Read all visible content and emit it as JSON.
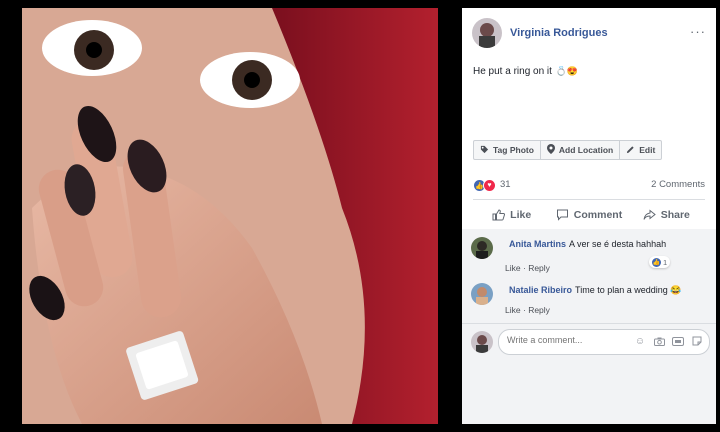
{
  "post": {
    "author_name": "Virginia Rodrigues",
    "more_label": "···",
    "caption": "He put a ring on it",
    "caption_emoji": "💍😍"
  },
  "toolbar": {
    "tag_photo": "Tag Photo",
    "add_location": "Add Location",
    "edit": "Edit"
  },
  "stats": {
    "reaction_count": "31",
    "comments_count": "2 Comments"
  },
  "actions": {
    "like": "Like",
    "comment": "Comment",
    "share": "Share"
  },
  "comments": [
    {
      "name": "Anita Martins",
      "text": "A ver se é desta hahhah",
      "like": "Like",
      "reply": "Reply",
      "separator": "·",
      "reactions": "1"
    },
    {
      "name": "Natalie Ribeiro",
      "text": "Time to plan a wedding 😂",
      "like": "Like",
      "reply": "Reply",
      "separator": "·"
    }
  ],
  "write_comment": {
    "placeholder": "Write a comment..."
  },
  "icons": {
    "more": "more-icon",
    "tag": "tag-icon",
    "location": "location-pin-icon",
    "edit": "pencil-icon",
    "like": "thumbs-up-icon",
    "comment": "speech-bubble-icon",
    "share": "share-arrow-icon",
    "emoji": "emoji-icon",
    "camera": "camera-icon",
    "gif": "gif-icon",
    "sticker": "sticker-icon"
  },
  "colors": {
    "name_link": "#385898",
    "like_blue": "#4267b2",
    "love_red": "#f0284a",
    "background": "#000000"
  }
}
